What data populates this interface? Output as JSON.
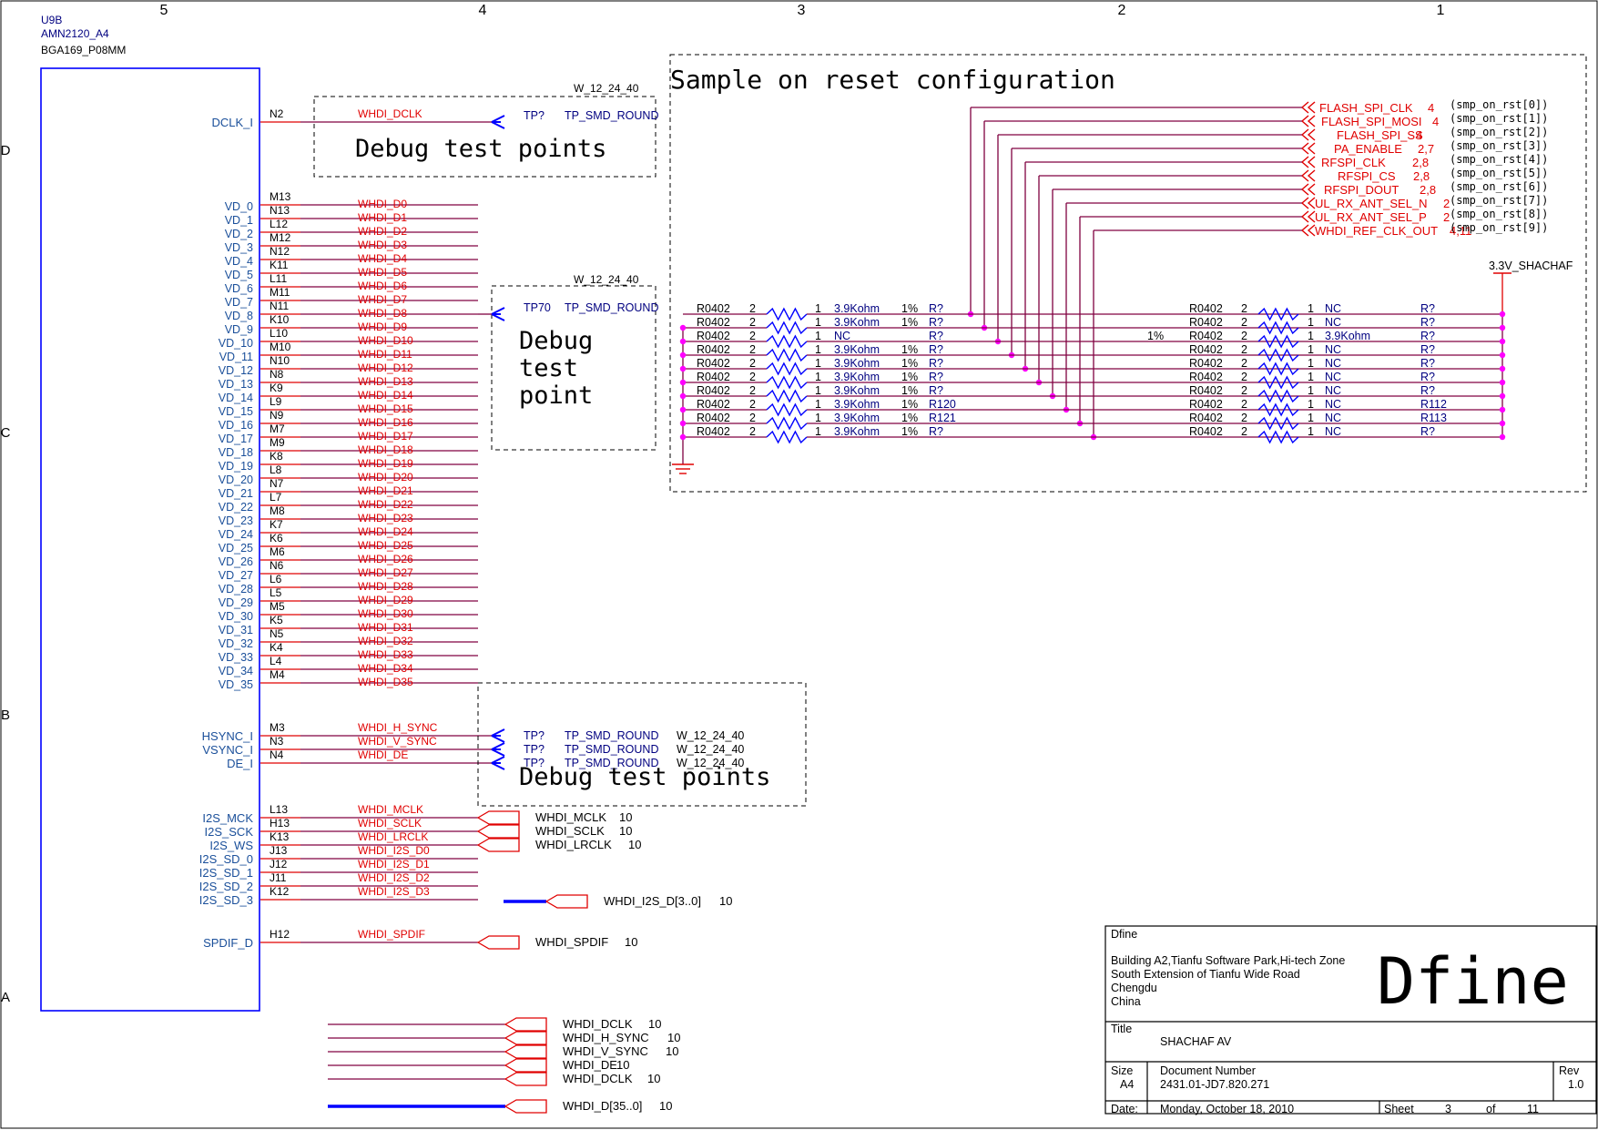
{
  "frame": {
    "columns": [
      "5",
      "4",
      "3",
      "2",
      "1"
    ],
    "rows": [
      "D",
      "C",
      "B",
      "A"
    ]
  },
  "part": {
    "ref": "U9B",
    "name": "AMN2120_A4",
    "package": "BGA169_P08MM"
  },
  "pins": {
    "dclk": {
      "name": "DCLK_I",
      "num": "N2",
      "net": "WHDI_DCLK"
    },
    "vd": [
      {
        "name": "VD_0",
        "num": "M13",
        "net": "WHDI_D0"
      },
      {
        "name": "VD_1",
        "num": "N13",
        "net": "WHDI_D1"
      },
      {
        "name": "VD_2",
        "num": "L12",
        "net": "WHDI_D2"
      },
      {
        "name": "VD_3",
        "num": "M12",
        "net": "WHDI_D3"
      },
      {
        "name": "VD_4",
        "num": "N12",
        "net": "WHDI_D4"
      },
      {
        "name": "VD_5",
        "num": "K11",
        "net": "WHDI_D5"
      },
      {
        "name": "VD_6",
        "num": "L11",
        "net": "WHDI_D6"
      },
      {
        "name": "VD_7",
        "num": "M11",
        "net": "WHDI_D7"
      },
      {
        "name": "VD_8",
        "num": "N11",
        "net": "WHDI_D8"
      },
      {
        "name": "VD_9",
        "num": "K10",
        "net": "WHDI_D9"
      },
      {
        "name": "VD_10",
        "num": "L10",
        "net": "WHDI_D10"
      },
      {
        "name": "VD_11",
        "num": "M10",
        "net": "WHDI_D11"
      },
      {
        "name": "VD_12",
        "num": "N10",
        "net": "WHDI_D12"
      },
      {
        "name": "VD_13",
        "num": "N8",
        "net": "WHDI_D13"
      },
      {
        "name": "VD_14",
        "num": "K9",
        "net": "WHDI_D14"
      },
      {
        "name": "VD_15",
        "num": "L9",
        "net": "WHDI_D15"
      },
      {
        "name": "VD_16",
        "num": "N9",
        "net": "WHDI_D16"
      },
      {
        "name": "VD_17",
        "num": "M7",
        "net": "WHDI_D17"
      },
      {
        "name": "VD_18",
        "num": "M9",
        "net": "WHDI_D18"
      },
      {
        "name": "VD_19",
        "num": "K8",
        "net": "WHDI_D19"
      },
      {
        "name": "VD_20",
        "num": "L8",
        "net": "WHDI_D20"
      },
      {
        "name": "VD_21",
        "num": "N7",
        "net": "WHDI_D21"
      },
      {
        "name": "VD_22",
        "num": "L7",
        "net": "WHDI_D22"
      },
      {
        "name": "VD_23",
        "num": "M8",
        "net": "WHDI_D23"
      },
      {
        "name": "VD_24",
        "num": "K7",
        "net": "WHDI_D24"
      },
      {
        "name": "VD_25",
        "num": "K6",
        "net": "WHDI_D25"
      },
      {
        "name": "VD_26",
        "num": "M6",
        "net": "WHDI_D26"
      },
      {
        "name": "VD_27",
        "num": "N6",
        "net": "WHDI_D27"
      },
      {
        "name": "VD_28",
        "num": "L6",
        "net": "WHDI_D28"
      },
      {
        "name": "VD_29",
        "num": "L5",
        "net": "WHDI_D29"
      },
      {
        "name": "VD_30",
        "num": "M5",
        "net": "WHDI_D30"
      },
      {
        "name": "VD_31",
        "num": "K5",
        "net": "WHDI_D31"
      },
      {
        "name": "VD_32",
        "num": "N5",
        "net": "WHDI_D32"
      },
      {
        "name": "VD_33",
        "num": "K4",
        "net": "WHDI_D33"
      },
      {
        "name": "VD_34",
        "num": "L4",
        "net": "WHDI_D34"
      },
      {
        "name": "VD_35",
        "num": "M4",
        "net": "WHDI_D35"
      }
    ],
    "sync": [
      {
        "name": "HSYNC_I",
        "num": "M3",
        "net": "WHDI_H_SYNC"
      },
      {
        "name": "VSYNC_I",
        "num": "N3",
        "net": "WHDI_V_SYNC"
      },
      {
        "name": "DE_I",
        "num": "N4",
        "net": "WHDI_DE"
      }
    ],
    "i2s": [
      {
        "name": "I2S_MCK",
        "num": "L13",
        "net": "WHDI_MCLK"
      },
      {
        "name": "I2S_SCK",
        "num": "H13",
        "net": "WHDI_SCLK"
      },
      {
        "name": "I2S_WS",
        "num": "K13",
        "net": "WHDI_LRCLK"
      },
      {
        "name": "I2S_SD_0",
        "num": "J13",
        "net": "WHDI_I2S_D0"
      },
      {
        "name": "I2S_SD_1",
        "num": "J12",
        "net": "WHDI_I2S_D1"
      },
      {
        "name": "I2S_SD_2",
        "num": "J11",
        "net": "WHDI_I2S_D2"
      },
      {
        "name": "I2S_SD_3",
        "num": "K12",
        "net": "WHDI_I2S_D3"
      }
    ],
    "spdif": {
      "name": "SPDIF_D",
      "num": "H12",
      "net": "WHDI_SPDIF"
    }
  },
  "testpoints": {
    "tp1": {
      "ref": "TP?",
      "value": "TP_SMD_ROUND",
      "footprint": "W_12_24_40",
      "title": "Debug test points"
    },
    "tp2": {
      "ref": "TP70",
      "value": "TP_SMD_ROUND",
      "footprint": "W_12_24_40",
      "title_lines": [
        "Debug",
        "test",
        "point"
      ]
    },
    "tp3": {
      "rows": [
        {
          "ref": "TP?",
          "value": "TP_SMD_ROUND",
          "footprint": "W_12_24_40"
        },
        {
          "ref": "TP?",
          "value": "TP_SMD_ROUND",
          "footprint": "W_12_24_40"
        },
        {
          "ref": "TP?",
          "value": "TP_SMD_ROUND",
          "footprint": "W_12_24_40"
        }
      ],
      "title": "Debug test points"
    }
  },
  "offpage_audio": [
    {
      "label": "WHDI_MCLK",
      "page": "10"
    },
    {
      "label": "WHDI_SCLK",
      "page": "10"
    },
    {
      "label": "WHDI_LRCLK",
      "page": "10"
    }
  ],
  "offpage_i2s_bus": {
    "label": "WHDI_I2S_D[3..0]",
    "page": "10"
  },
  "offpage_spdif": {
    "label": "WHDI_SPDIF",
    "page": "10"
  },
  "offpage_bottom": [
    {
      "label": "WHDI_DCLK",
      "page": "10"
    },
    {
      "label": "WHDI_H_SYNC",
      "page": "10"
    },
    {
      "label": "WHDI_V_SYNC",
      "page": "10"
    },
    {
      "label": "WHDI_DE",
      "page": "10"
    },
    {
      "label": "WHDI_DCLK",
      "page": "10"
    }
  ],
  "offpage_bus": {
    "label": "WHDI_D[35..0]",
    "page": "10"
  },
  "reset_config": {
    "title": "Sample on reset configuration",
    "supply": "3.3V_SHACHAF",
    "nets": [
      {
        "label": "FLASH_SPI_CLK",
        "page": "4",
        "comment": "(smp_on_rst[0])"
      },
      {
        "label": "FLASH_SPI_MOSI",
        "page": "4",
        "comment": "(smp_on_rst[1])"
      },
      {
        "label": "FLASH_SPI_SS",
        "page": "4",
        "comment": "(smp_on_rst[2])"
      },
      {
        "label": "PA_ENABLE",
        "page": "2,7",
        "comment": "(smp_on_rst[3])"
      },
      {
        "label": "RFSPI_CLK",
        "page": "2,8",
        "comment": "(smp_on_rst[4])"
      },
      {
        "label": "RFSPI_CS",
        "page": "2,8",
        "comment": "(smp_on_rst[5])"
      },
      {
        "label": "RFSPI_DOUT",
        "page": "2,8",
        "comment": "(smp_on_rst[6])"
      },
      {
        "label": "UL_RX_ANT_SEL_N",
        "page": "2",
        "comment": "(smp_on_rst[7])"
      },
      {
        "label": "UL_RX_ANT_SEL_P",
        "page": "2",
        "comment": "(smp_on_rst[8])"
      },
      {
        "label": "WHDI_REF_CLK_OUT",
        "page": "4,11",
        "comment": "(smp_on_rst[9])"
      }
    ],
    "left_resistors": [
      {
        "pkg": "R0402",
        "p2": "2",
        "p1": "1",
        "val": "3.9Kohm",
        "tol": "1%",
        "ref": "R?"
      },
      {
        "pkg": "R0402",
        "p2": "2",
        "p1": "1",
        "val": "3.9Kohm",
        "tol": "1%",
        "ref": "R?"
      },
      {
        "pkg": "R0402",
        "p2": "2",
        "p1": "1",
        "val": "NC",
        "tol": "",
        "ref": "R?"
      },
      {
        "pkg": "R0402",
        "p2": "2",
        "p1": "1",
        "val": "3.9Kohm",
        "tol": "1%",
        "ref": "R?"
      },
      {
        "pkg": "R0402",
        "p2": "2",
        "p1": "1",
        "val": "3.9Kohm",
        "tol": "1%",
        "ref": "R?"
      },
      {
        "pkg": "R0402",
        "p2": "2",
        "p1": "1",
        "val": "3.9Kohm",
        "tol": "1%",
        "ref": "R?"
      },
      {
        "pkg": "R0402",
        "p2": "2",
        "p1": "1",
        "val": "3.9Kohm",
        "tol": "1%",
        "ref": "R?"
      },
      {
        "pkg": "R0402",
        "p2": "2",
        "p1": "1",
        "val": "3.9Kohm",
        "tol": "1%",
        "ref": "R120"
      },
      {
        "pkg": "R0402",
        "p2": "2",
        "p1": "1",
        "val": "3.9Kohm",
        "tol": "1%",
        "ref": "R121"
      },
      {
        "pkg": "R0402",
        "p2": "2",
        "p1": "1",
        "val": "3.9Kohm",
        "tol": "1%",
        "ref": "R?"
      }
    ],
    "right_resistors": [
      {
        "tol": "",
        "pkg": "R0402",
        "p2": "2",
        "p1": "1",
        "val": "NC",
        "ref": "R?"
      },
      {
        "tol": "",
        "pkg": "R0402",
        "p2": "2",
        "p1": "1",
        "val": "NC",
        "ref": "R?"
      },
      {
        "tol": "1%",
        "pkg": "R0402",
        "p2": "2",
        "p1": "1",
        "val": "3.9Kohm",
        "ref": "R?"
      },
      {
        "tol": "",
        "pkg": "R0402",
        "p2": "2",
        "p1": "1",
        "val": "NC",
        "ref": "R?"
      },
      {
        "tol": "",
        "pkg": "R0402",
        "p2": "2",
        "p1": "1",
        "val": "NC",
        "ref": "R?"
      },
      {
        "tol": "",
        "pkg": "R0402",
        "p2": "2",
        "p1": "1",
        "val": "NC",
        "ref": "R?"
      },
      {
        "tol": "",
        "pkg": "R0402",
        "p2": "2",
        "p1": "1",
        "val": "NC",
        "ref": "R?"
      },
      {
        "tol": "",
        "pkg": "R0402",
        "p2": "2",
        "p1": "1",
        "val": "NC",
        "ref": "R112"
      },
      {
        "tol": "",
        "pkg": "R0402",
        "p2": "2",
        "p1": "1",
        "val": "NC",
        "ref": "R113"
      },
      {
        "tol": "",
        "pkg": "R0402",
        "p2": "2",
        "p1": "1",
        "val": "NC",
        "ref": "R?"
      }
    ]
  },
  "title_block": {
    "company": "Dfine",
    "address": [
      "Building A2,Tianfu Software Park,Hi-tech Zone",
      "South Extension of Tianfu Wide Road",
      "Chengdu",
      "China"
    ],
    "logo": "Dfine",
    "title_label": "Title",
    "title": "SHACHAF AV",
    "size_label": "Size",
    "size": "A4",
    "docnum_label": "Document Number",
    "docnum": "2431.01-JD7.820.271",
    "rev_label": "Rev",
    "rev": "1.0",
    "date_label": "Date:",
    "date": "Monday, October 18, 2010",
    "sheet_label": "Sheet",
    "sheet": "3",
    "of_label": "of",
    "total": "11"
  },
  "colors": {
    "wire": "#800040",
    "net": "#e00000",
    "pin": "#1a4f9a",
    "navy": "#000080",
    "body": "#0000ff",
    "junction": "#ff00ff"
  }
}
